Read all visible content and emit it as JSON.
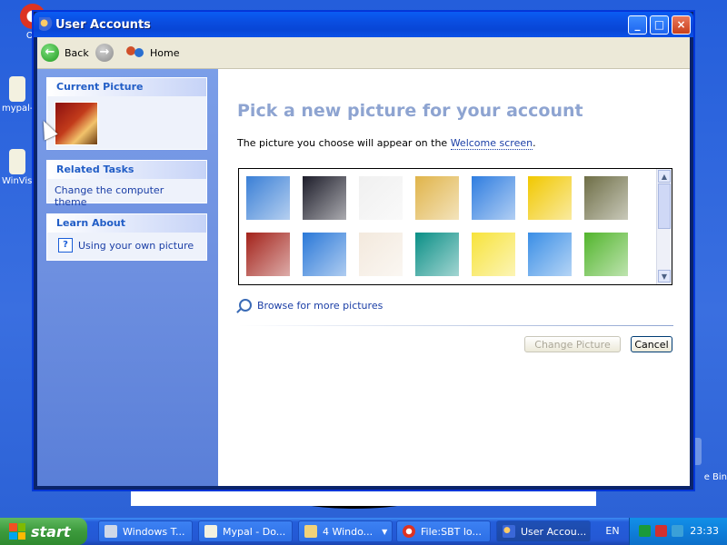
{
  "desktop": {
    "icons": [
      {
        "label": "Op"
      },
      {
        "label": "mypal-"
      },
      {
        "label": "WinVis"
      }
    ],
    "recycle_label": "e Bin"
  },
  "window": {
    "title": "User Accounts",
    "buttons": {
      "minimize": "_",
      "maximize": "□",
      "close": "×"
    }
  },
  "toolbar": {
    "back_label": "Back",
    "home_label": "Home"
  },
  "left_pane": {
    "current_picture": {
      "heading": "Current Picture"
    },
    "related_tasks": {
      "heading": "Related Tasks",
      "items": [
        "Change the computer theme"
      ]
    },
    "learn_about": {
      "heading": "Learn About",
      "items": [
        "Using your own picture"
      ]
    }
  },
  "main": {
    "title": "Pick a new picture for your account",
    "desc_before": "The picture you choose will appear on the ",
    "desc_link": "Welcome screen",
    "desc_after": ".",
    "pictures": [
      {
        "name": "airplane",
        "color": "#3a7fd6"
      },
      {
        "name": "astronaut",
        "color": "#1d1d2a"
      },
      {
        "name": "soccer-ball",
        "color": "#f0f0f0"
      },
      {
        "name": "beach-chair",
        "color": "#e0b44a"
      },
      {
        "name": "butterfly",
        "color": "#2f7de0"
      },
      {
        "name": "car",
        "color": "#f1c800"
      },
      {
        "name": "owl",
        "color": "#6e6e46"
      },
      {
        "name": "chess",
        "color": "#a3221a"
      },
      {
        "name": "dirt-bike",
        "color": "#2a78d8"
      },
      {
        "name": "dog",
        "color": "#f3e9dd"
      },
      {
        "name": "drip",
        "color": "#0a8f86"
      },
      {
        "name": "duck",
        "color": "#f7e33b"
      },
      {
        "name": "fish",
        "color": "#3a8ee6"
      },
      {
        "name": "frog",
        "color": "#52b52c"
      }
    ],
    "browse_label": "Browse for more pictures",
    "change_button": "Change Picture",
    "cancel_button": "Cancel"
  },
  "taskbar": {
    "start_label": "start",
    "tasks": [
      {
        "label": "Windows T..."
      },
      {
        "label": "Mypal - Do..."
      },
      {
        "label": "4 Windo..."
      },
      {
        "label": "File:SBT lo..."
      },
      {
        "label": "User Accou..."
      }
    ],
    "language": "EN",
    "clock": "23:33"
  }
}
